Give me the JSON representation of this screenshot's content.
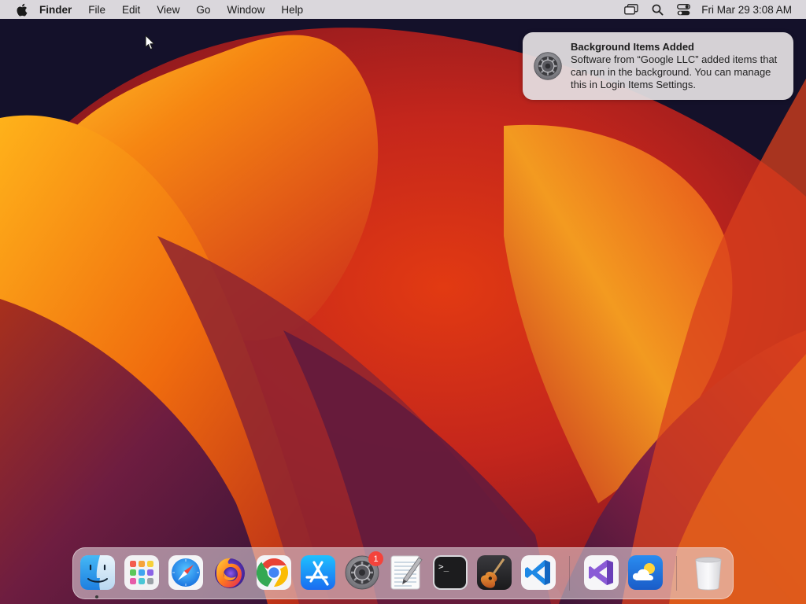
{
  "menubar": {
    "app_name": "Finder",
    "items": [
      "File",
      "Edit",
      "View",
      "Go",
      "Window",
      "Help"
    ],
    "status_icons": [
      "screen-mirroring-icon",
      "spotlight-search-icon",
      "control-center-icon"
    ],
    "clock": "Fri Mar 29  3:08 AM"
  },
  "notification": {
    "title": "Background Items Added",
    "body": "Software from “Google LLC” added items that can run in the background. You can manage this in Login Items Settings.",
    "icon": "system-settings-icon"
  },
  "dock": {
    "apps": [
      {
        "name": "finder",
        "icon": "finder-icon",
        "running": true
      },
      {
        "name": "launchpad",
        "icon": "launchpad-icon"
      },
      {
        "name": "safari",
        "icon": "safari-icon"
      },
      {
        "name": "firefox",
        "icon": "firefox-icon"
      },
      {
        "name": "chrome",
        "icon": "chrome-icon"
      },
      {
        "name": "app-store",
        "icon": "app-store-icon"
      },
      {
        "name": "system-settings",
        "icon": "system-settings-icon",
        "badge": "1"
      },
      {
        "name": "textedit",
        "icon": "textedit-icon"
      },
      {
        "name": "terminal",
        "icon": "terminal-icon",
        "prompt": ">_"
      },
      {
        "name": "garageband",
        "icon": "garageband-icon"
      },
      {
        "name": "vscode",
        "icon": "vscode-icon"
      },
      {
        "name": "visual-studio",
        "icon": "visual-studio-icon"
      },
      {
        "name": "weather",
        "icon": "weather-icon"
      },
      {
        "name": "trash",
        "icon": "trash-icon"
      }
    ]
  },
  "colors": {
    "wallpaper_dark": "#14112a",
    "wallpaper_orange": "#f07a12",
    "wallpaper_red": "#c42a1e",
    "wallpaper_purple": "#5a1a4a",
    "badge_red": "#f4433b"
  }
}
